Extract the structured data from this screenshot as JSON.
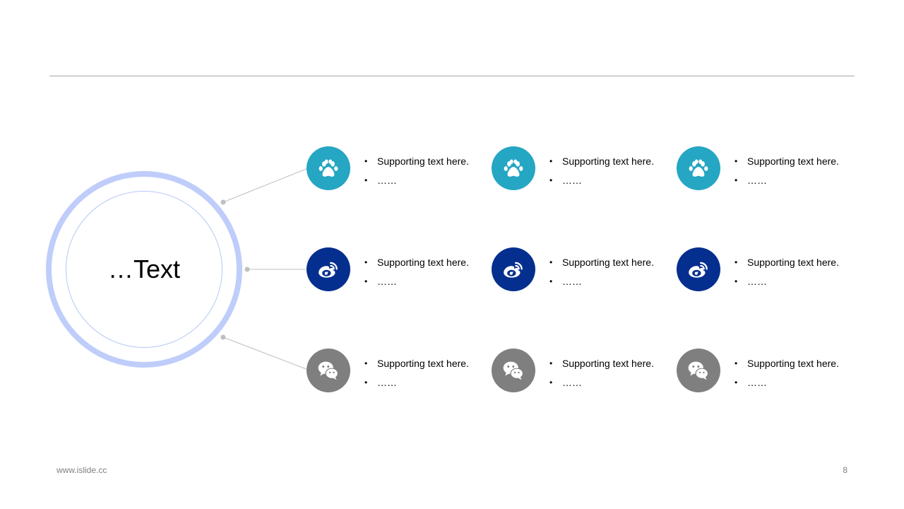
{
  "center": {
    "title": "…Text"
  },
  "colors": {
    "row1": "#25a6c3",
    "row2": "#052f8e",
    "row3": "#7f7f7f",
    "ring": "#bfcdfa"
  },
  "rows": [
    {
      "icon": "paw-icon",
      "items": [
        {
          "line1": "Supporting text here.",
          "line2": "……"
        },
        {
          "line1": "Supporting text here.",
          "line2": "……"
        },
        {
          "line1": "Supporting text here.",
          "line2": "……"
        }
      ]
    },
    {
      "icon": "weibo-icon",
      "items": [
        {
          "line1": "Supporting text here.",
          "line2": "……"
        },
        {
          "line1": "Supporting text here.",
          "line2": "……"
        },
        {
          "line1": "Supporting text here.",
          "line2": "……"
        }
      ]
    },
    {
      "icon": "wechat-icon",
      "items": [
        {
          "line1": "Supporting text here.",
          "line2": "……"
        },
        {
          "line1": "Supporting text here.",
          "line2": "……"
        },
        {
          "line1": "Supporting text here.",
          "line2": "……"
        }
      ]
    }
  ],
  "footer": {
    "url": "www.islide.cc",
    "page": "8"
  }
}
